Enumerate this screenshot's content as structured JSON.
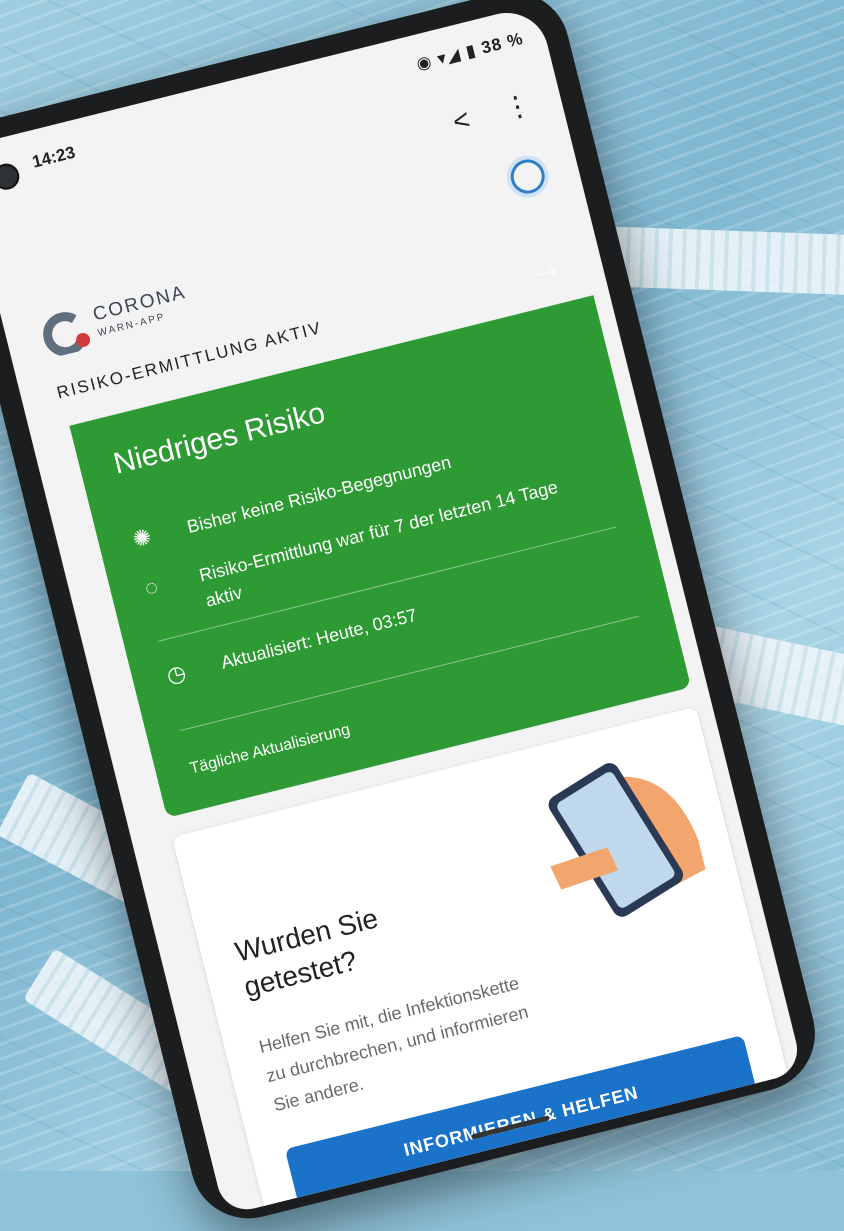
{
  "status_bar": {
    "time": "14:23",
    "battery": "38 %",
    "icons": "◉ ▾◢ ▮"
  },
  "toolbar": {
    "share_icon": "share-icon",
    "menu_icon": "more-vert-icon"
  },
  "app": {
    "name_line1": "CORONA",
    "name_line2": "WARN-APP"
  },
  "risk": {
    "section_title": "RISIKO-ERMITTLUNG AKTIV",
    "level": "Niedriges Risiko",
    "encounters": "Bisher keine Risiko-Begegnungen",
    "active_days": "Risiko-Ermittlung war für 7 der letzten 14 Tage aktiv",
    "updated": "Aktualisiert: Heute, 03:57",
    "daily_update": "Tägliche Aktualisierung",
    "color": "#2e9a34"
  },
  "test_card": {
    "title": "Wurden Sie getestet?",
    "body": "Helfen Sie mit, die Infektionskette zu durchbrechen, und informieren Sie andere.",
    "button_label": "INFORMIEREN & HELFEN",
    "button_color": "#1b72c9"
  }
}
